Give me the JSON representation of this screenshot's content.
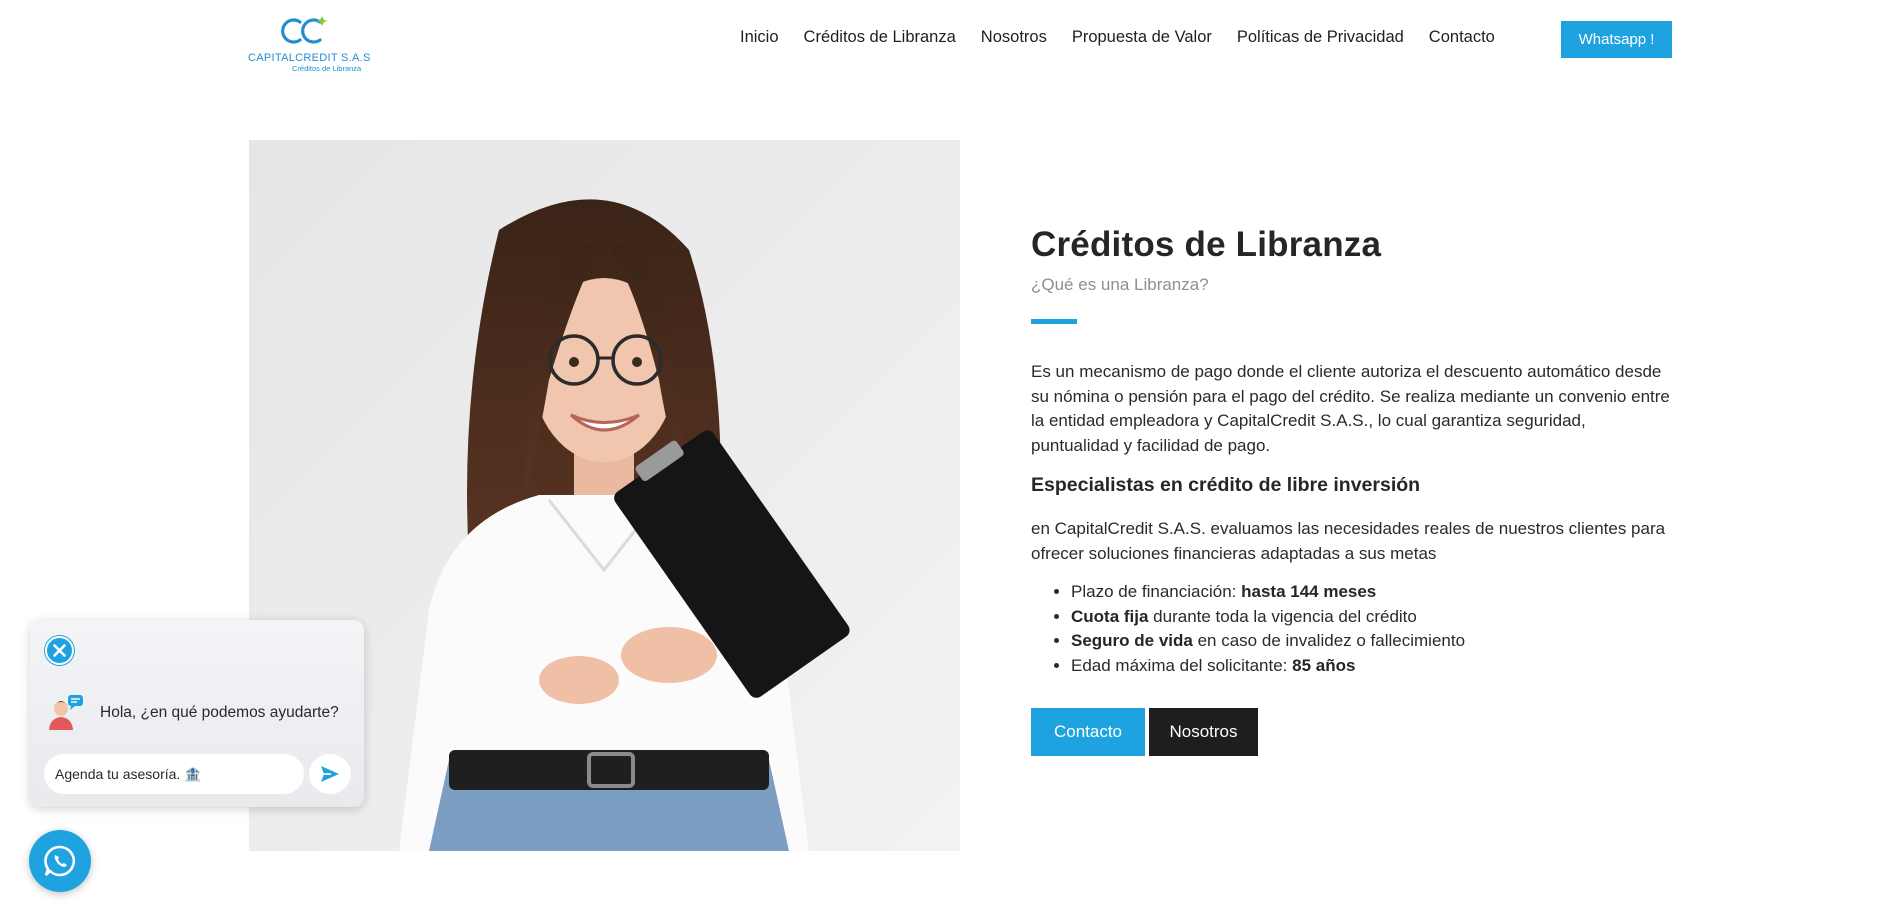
{
  "brand": {
    "name": "CAPITALCREDIT S.A.S",
    "tagline": "Créditos de Libranza",
    "accent": "#1fa3e0",
    "dark": "#1e1e1e"
  },
  "nav": {
    "items": [
      {
        "label": "Inicio"
      },
      {
        "label": "Créditos de Libranza"
      },
      {
        "label": "Nosotros"
      },
      {
        "label": "Propuesta de Valor"
      },
      {
        "label": "Políticas de Privacidad"
      },
      {
        "label": "Contacto"
      }
    ],
    "whatsapp_label": "Whatsapp !"
  },
  "hero": {
    "image_icon": "woman-with-clipboard-photo"
  },
  "content": {
    "title": "Créditos de Libranza",
    "subtitle": "¿Qué es una Libranza?",
    "paragraph1": "Es un mecanismo de pago donde el cliente autoriza el descuento automático desde su nómina o pensión para el pago del crédito. Se realiza mediante un convenio entre la entidad empleadora y CapitalCredit S.A.S., lo cual garantiza seguridad, puntualidad y facilidad de pago.",
    "heading2": "Especialistas en crédito de libre inversión",
    "paragraph2": "en CapitalCredit S.A.S. evaluamos las necesidades reales de nuestros clientes para ofrecer soluciones financieras adaptadas a sus metas",
    "bullets": [
      {
        "pre": "Plazo de financiación: ",
        "bold": "hasta 144 meses",
        "post": ""
      },
      {
        "pre": "",
        "bold": "Cuota fija",
        "post": " durante toda la vigencia del crédito"
      },
      {
        "pre": "",
        "bold": "Seguro de vida",
        "post": " en caso de invalidez o fallecimiento"
      },
      {
        "pre": "Edad máxima del solicitante: ",
        "bold": "85 años",
        "post": ""
      }
    ],
    "btn_contact": "Contacto",
    "btn_about": "Nosotros"
  },
  "chat": {
    "greeting": "Hola, ¿en qué podemos ayudarte?",
    "input_value": "Agenda tu asesoría. 🏦",
    "close_icon": "close-icon",
    "send_icon": "send-icon",
    "avatar_icon": "support-agent-icon",
    "whatsapp_icon": "whatsapp-icon"
  }
}
